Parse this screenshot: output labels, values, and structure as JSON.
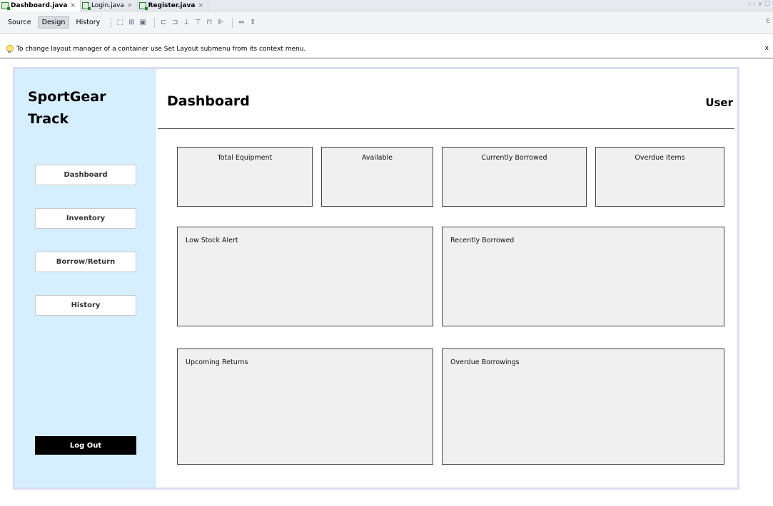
{
  "editor": {
    "tabs": [
      {
        "label": "Dashboard.java",
        "active": true
      },
      {
        "label": "Login.java",
        "active": false
      },
      {
        "label": "Register.java",
        "active": false
      }
    ],
    "tab_close": "×",
    "nav_arrows": "‹ › ∨ ☐"
  },
  "toolbar": {
    "source_label": "Source",
    "design_label": "Design",
    "history_label": "History",
    "right_glyph": "E"
  },
  "hint": {
    "text": "To change layout manager of a container use Set Layout submenu from its context menu.",
    "close": "x"
  },
  "app": {
    "brand_line1": "SportGear",
    "brand_line2": "Track",
    "title": "Dashboard",
    "user": "User",
    "nav": {
      "dashboard": "Dashboard",
      "inventory": "Inventory",
      "borrow_return": "Borrow/Return",
      "history": "History"
    },
    "logout": "Log Out",
    "stats": {
      "total_equipment": "Total Equipment",
      "available": "Available",
      "currently_borrowed": "Currently Borrowed",
      "overdue_items": "Overdue Items"
    },
    "panels": {
      "low_stock_alert": "Low Stock Alert",
      "recently_borrowed": "Recently Borrowed",
      "upcoming_returns": "Upcoming Returns",
      "overdue_borrowings": "Overdue Borrowings"
    }
  }
}
